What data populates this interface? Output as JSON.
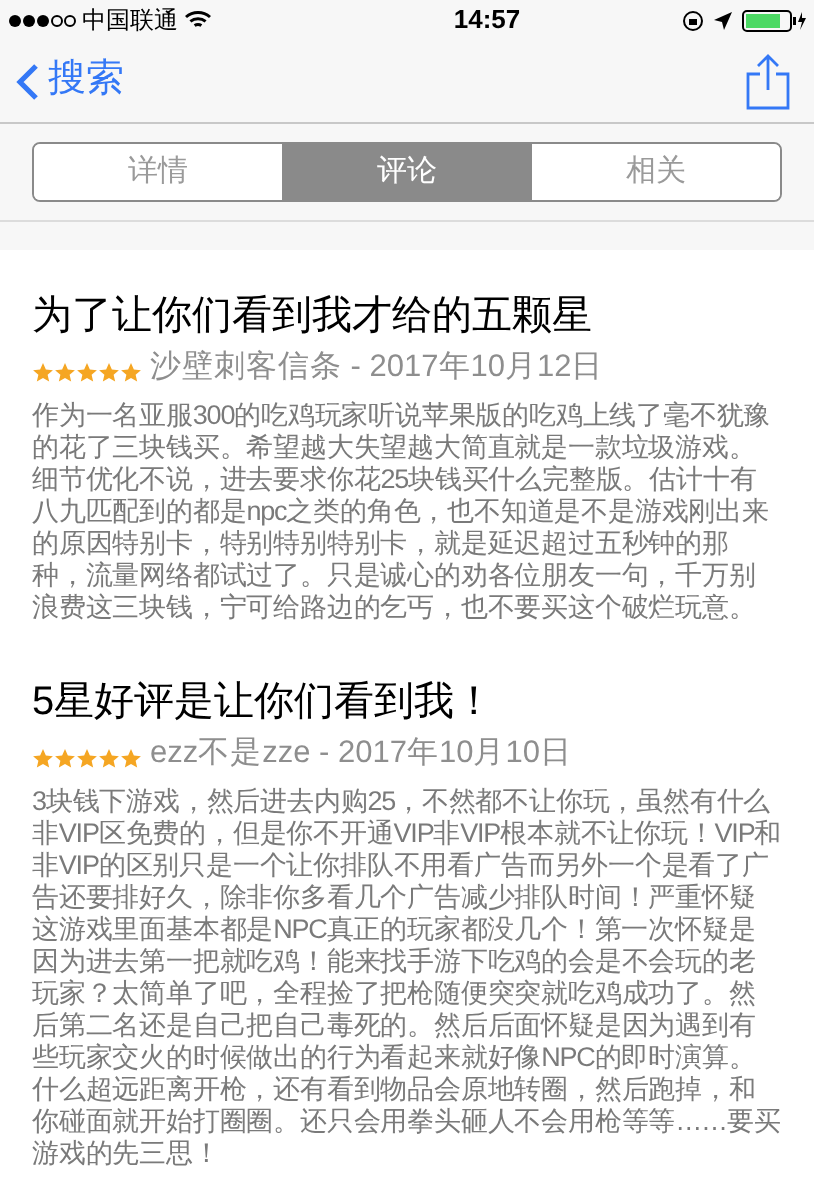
{
  "status_bar": {
    "carrier": "中国联通",
    "time": "14:57"
  },
  "nav": {
    "back": "搜索"
  },
  "tabs": [
    {
      "label": "详情",
      "selected": false
    },
    {
      "label": "评论",
      "selected": true
    },
    {
      "label": "相关",
      "selected": false
    }
  ],
  "reviews": [
    {
      "title": "为了让你们看到我才给的五颗星",
      "stars": 5,
      "meta": "沙壁刺客信条 - 2017年10月12日",
      "body": "作为一名亚服300的吃鸡玩家听说苹果版的吃鸡上线了毫不犹豫的花了三块钱买。希望越大失望越大简直就是一款垃圾游戏。细节优化不说，进去要求你花25块钱买什么完整版。估计十有八九匹配到的都是npc之类的角色，也不知道是不是游戏刚出来的原因特别卡，特别特别特别卡，就是延迟超过五秒钟的那种，流量网络都试过了。只是诚心的劝各位朋友一句，千万别浪费这三块钱，宁可给路边的乞丐，也不要买这个破烂玩意。"
    },
    {
      "title": "5星好评是让你们看到我！",
      "stars": 5,
      "meta": "ezz不是zze - 2017年10月10日",
      "body": "3块钱下游戏，然后进去内购25，不然都不让你玩，虽然有什么非VIP区免费的，但是你不开通VIP非VIP根本就不让你玩！VIP和非VIP的区别只是一个让你排队不用看广告而另外一个是看了广告还要排好久，除非你多看几个广告减少排队时间！严重怀疑这游戏里面基本都是NPC真正的玩家都没几个！第一次怀疑是因为进去第一把就吃鸡！能来找手游下吃鸡的会是不会玩的老玩家？太简单了吧，全程捡了把枪随便突突就吃鸡成功了。然后第二名还是自己把自己毒死的。然后后面怀疑是因为遇到有些玩家交火的时候做出的行为看起来就好像NPC的即时演算。什么超远距离开枪，还有看到物品会原地转圈，然后跑掉，和你碰面就开始打圈圈。还只会用拳头砸人不会用枪等等……要买游戏的先三思！"
    }
  ]
}
